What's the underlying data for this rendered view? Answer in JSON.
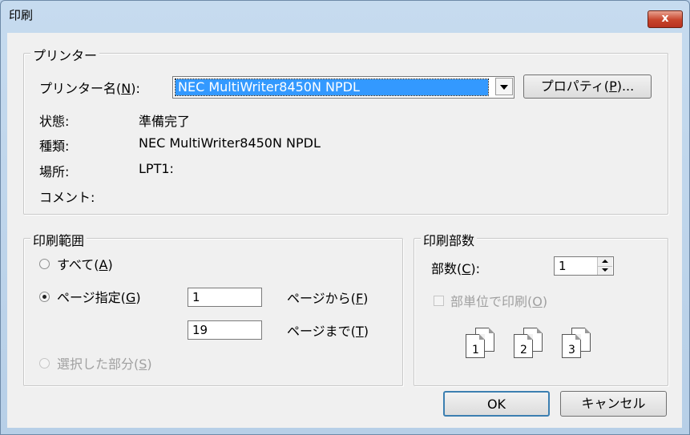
{
  "window": {
    "title": "印刷",
    "close_label": "x"
  },
  "printer": {
    "group_label": "プリンター",
    "name_label": "プリンター名(",
    "name_key": "N",
    "name_suffix": "):",
    "selected_printer": "NEC MultiWriter8450N NPDL",
    "properties_label": "プロパティ(",
    "properties_key": "P",
    "properties_suffix": ")...",
    "status_label": "状態:",
    "status_value": "準備完了",
    "type_label": "種類:",
    "type_value": "NEC MultiWriter8450N NPDL",
    "location_label": "場所:",
    "location_value": "LPT1:",
    "comment_label": "コメント:",
    "comment_value": ""
  },
  "range": {
    "group_label": "印刷範囲",
    "all_label": "すべて(",
    "all_key": "A",
    "all_suffix": ")",
    "pages_label": "ページ指定(",
    "pages_key": "G",
    "pages_suffix": ")",
    "from_value": "1",
    "from_label": "ページから(",
    "from_key": "F",
    "from_suffix": ")",
    "to_value": "19",
    "to_label": "ページまで(",
    "to_key": "T",
    "to_suffix": ")",
    "selection_label": "選択した部分(",
    "selection_key": "S",
    "selection_suffix": ")",
    "selected_option": "pages"
  },
  "copies": {
    "group_label": "印刷部数",
    "count_label": "部数(",
    "count_key": "C",
    "count_suffix": "):",
    "count_value": "1",
    "collate_label": "部単位で印刷(",
    "collate_key": "O",
    "collate_suffix": ")",
    "collate_checked": false,
    "collate_enabled": false,
    "collate_pages": [
      {
        "back": "1",
        "front": "1"
      },
      {
        "back": "2",
        "front": "2"
      },
      {
        "back": "3",
        "front": "3"
      }
    ]
  },
  "buttons": {
    "ok": "OK",
    "cancel": "キャンセル"
  }
}
